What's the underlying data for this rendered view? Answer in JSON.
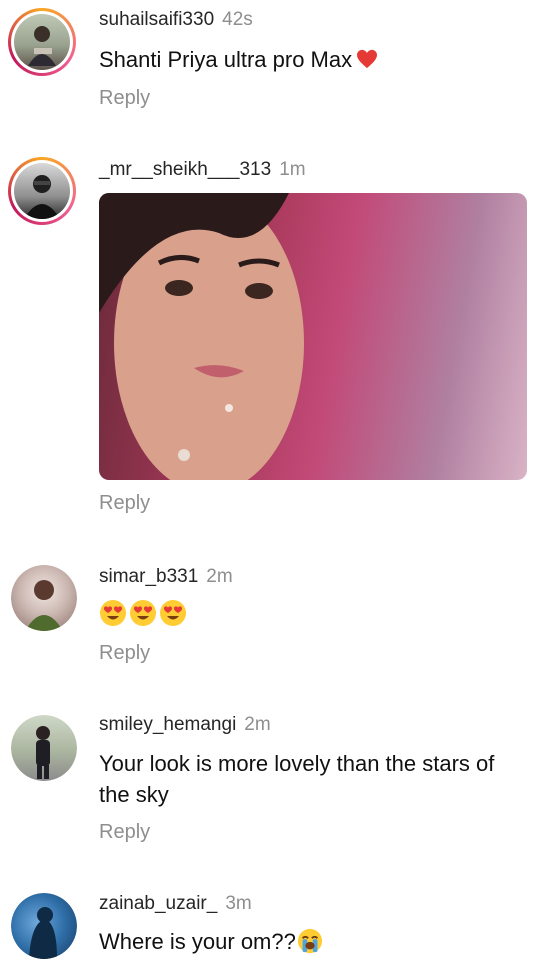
{
  "comments": [
    {
      "username": "suhailsaifi330",
      "time": "42s",
      "text": "Shanti Priya ultra pro Max",
      "emoji": "red-heart",
      "reply_label": "Reply",
      "avatar_ring": true
    },
    {
      "username": "_mr__sheikh___313",
      "time": "1m",
      "attachment": "gif-image",
      "reply_label": "Reply",
      "avatar_ring": true
    },
    {
      "username": "simar_b331",
      "time": "2m",
      "emojis": [
        "heart-eyes-face",
        "heart-eyes-face",
        "heart-eyes-face"
      ],
      "reply_label": "Reply",
      "avatar_ring": false
    },
    {
      "username": "smiley_hemangi",
      "time": "2m",
      "text": "Your look is more lovely than the stars of the sky",
      "reply_label": "Reply",
      "avatar_ring": false
    },
    {
      "username": "zainab_uzair_",
      "time": "3m",
      "text": "Where is your om??",
      "emoji": "loudly-crying-face",
      "avatar_ring": false
    }
  ],
  "colors": {
    "username": "#262626",
    "timestamp": "#8e8e8e",
    "reply": "#8e8e8e",
    "story_ring": "#f06292"
  }
}
